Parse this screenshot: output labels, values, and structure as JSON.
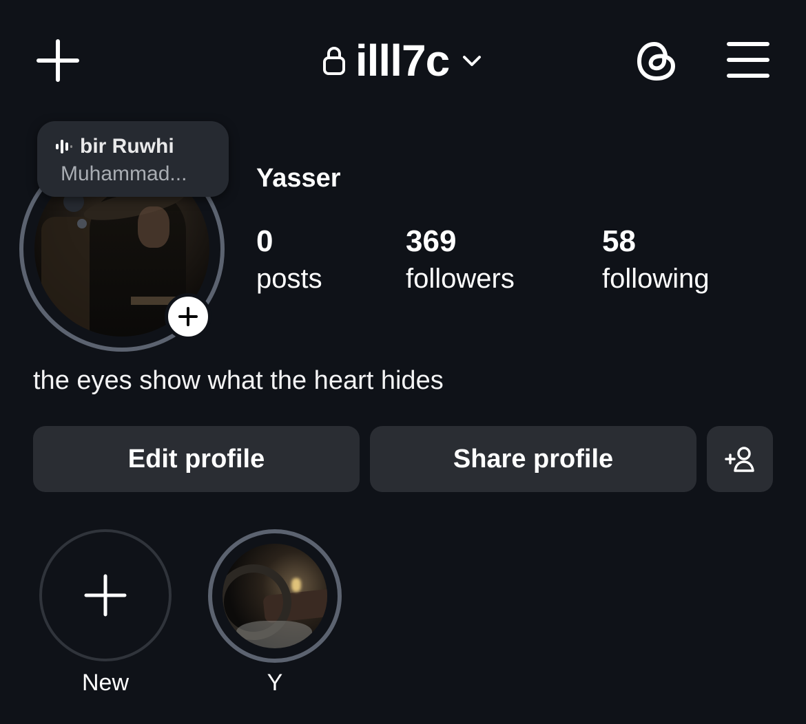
{
  "theme": {
    "background": "#0f1218",
    "button_bg": "#2a2d33",
    "ring": "#5c6370"
  },
  "header": {
    "username": "illl7c",
    "icons": [
      "plus-icon",
      "lock-icon",
      "chevron-down-icon",
      "threads-icon",
      "hamburger-menu-icon"
    ]
  },
  "note": {
    "title": "bir Ruwhi",
    "subtitle": "Muhammad..."
  },
  "profile": {
    "display_name": "Yasser",
    "stats": [
      {
        "value": "0",
        "label": "posts"
      },
      {
        "value": "369",
        "label": "followers"
      },
      {
        "value": "58",
        "label": "following"
      }
    ],
    "bio": "the eyes show what the heart hides"
  },
  "actions": {
    "edit_label": "Edit profile",
    "share_label": "Share profile",
    "add_person_icon": "add-person-icon"
  },
  "highlights": [
    {
      "label": "New"
    },
    {
      "label": "Y"
    }
  ]
}
